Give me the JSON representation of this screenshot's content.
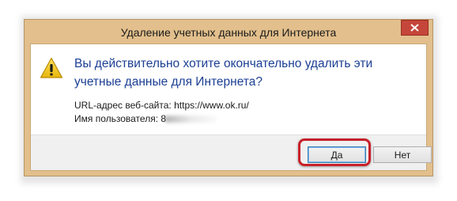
{
  "window": {
    "title": "Удаление учетных данных для Интернета",
    "close_icon": "close-icon",
    "frame_color": "#e2bf8c"
  },
  "dialog": {
    "icon": "warning-icon",
    "main_instruction": "Вы действительно хотите окончательно удалить эти учетные данные для Интернета?",
    "url_label": "URL-адрес веб-сайта:",
    "url_value": "https://www.ok.ru/",
    "username_label": "Имя пользователя:",
    "username_value": "8"
  },
  "buttons": {
    "yes_label": "Да",
    "no_label": "Нет"
  },
  "colors": {
    "instruction_text": "#1c3f94",
    "highlight": "#c7202a",
    "close_button": "#c5463a"
  }
}
